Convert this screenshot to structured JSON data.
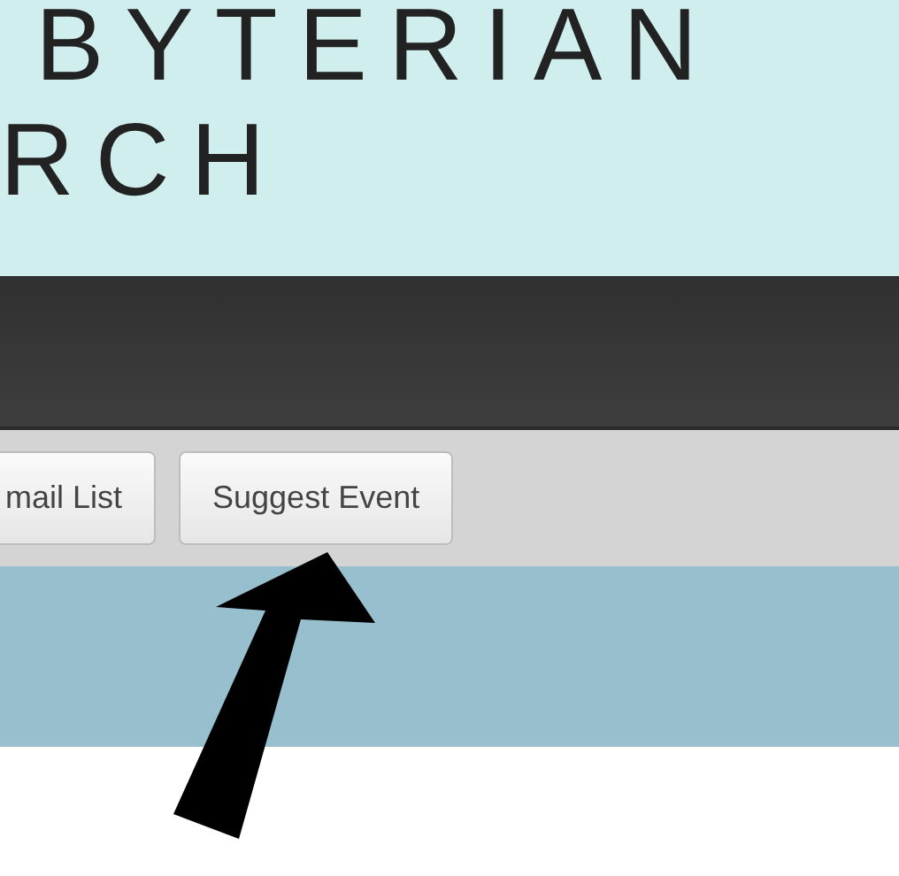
{
  "header": {
    "title_lines": [
      "BYTERIAN",
      "RCH"
    ]
  },
  "buttons": [
    "mail List",
    "Suggest Event"
  ]
}
